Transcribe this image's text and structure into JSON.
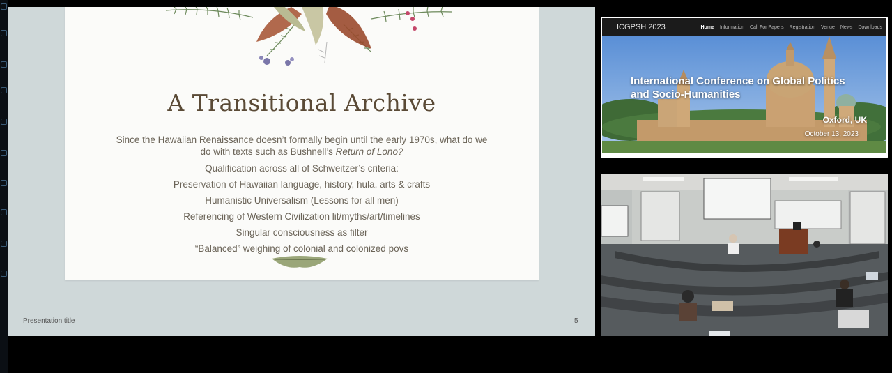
{
  "slide": {
    "title": "A Transitional Archive",
    "intro_line1": "Since the Hawaiian Renaissance doesn’t formally begin until the early 1970s, what do we",
    "intro_line2_prefix": "do with texts such as Bushnell’s ",
    "intro_book": "Return of Lono?",
    "points": [
      "Qualification across all of Schweitzer’s criteria:",
      "Preservation of Hawaiian language, history, hula, arts & crafts",
      "Humanistic Universalism (Lessons for all men)",
      "Referencing of Western Civilization lit/myths/art/timelines",
      "Singular consciousness as filter",
      "“Balanced” weighing of colonial and colonized povs"
    ],
    "footer_title": "Presentation title",
    "page_number": "5"
  },
  "website": {
    "logo": "ICGPSH 2023",
    "nav": [
      "Home",
      "Information",
      "Call For Papers",
      "Registration",
      "Venue",
      "News",
      "Downloads"
    ],
    "hero_title": "International Conference on Global Politics and Socio-Humanities",
    "location": "Oxford, UK",
    "date": "October 13, 2023"
  },
  "colors": {
    "slide_background": "#cfd8d9",
    "slide_card": "#fbfbf9",
    "title_text": "#5a4a36",
    "site_nav": "#1b1b1b"
  }
}
